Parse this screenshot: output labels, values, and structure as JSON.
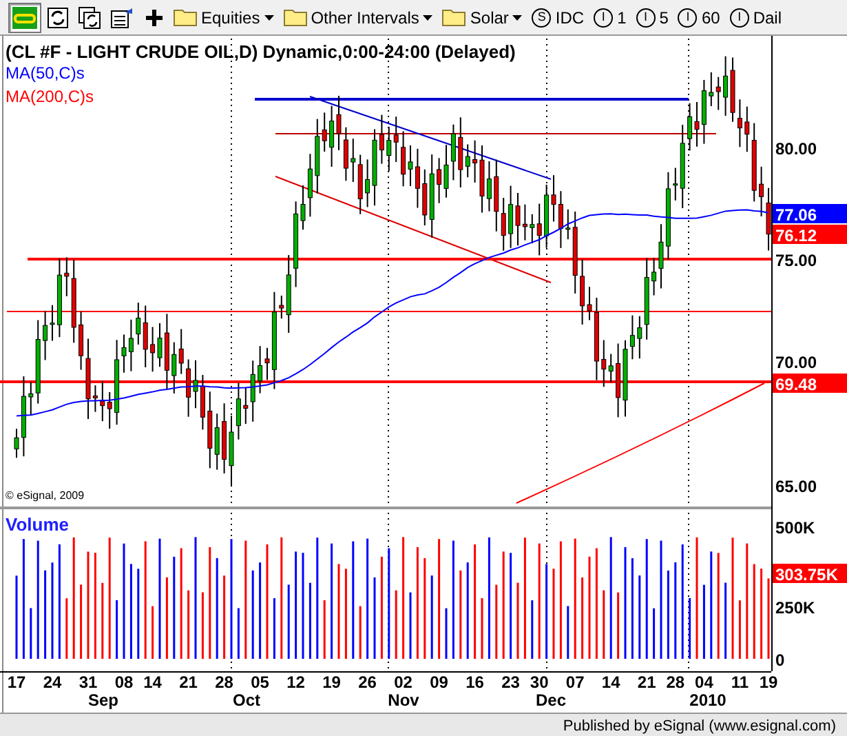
{
  "toolbar": {
    "buttons": [
      {
        "kind": "link",
        "selected": true
      },
      {
        "kind": "refresh",
        "selected": false
      },
      {
        "kind": "refresh-all",
        "selected": false
      },
      {
        "kind": "properties",
        "selected": false
      },
      {
        "kind": "add",
        "selected": false
      }
    ],
    "menus": [
      {
        "label": "Equities"
      },
      {
        "label": "Other Intervals"
      },
      {
        "label": "Solar"
      }
    ],
    "intervals": [
      {
        "badge": "S",
        "label": "IDC"
      },
      {
        "badge": "I",
        "label": "1"
      },
      {
        "badge": "I",
        "label": "5"
      },
      {
        "badge": "I",
        "label": "60"
      },
      {
        "badge": "I",
        "label": "Dail"
      }
    ]
  },
  "chart": {
    "title": "(CL #F - LIGHT CRUDE OIL,D) Dynamic,0:00-24:00 (Delayed)",
    "legends": [
      {
        "label": "MA(50,C)s",
        "color": "#0000ff"
      },
      {
        "label": "MA(200,C)s",
        "color": "#ff0000"
      }
    ],
    "y_ticks": [
      "80.00",
      "75.00",
      "70.00",
      "65.00"
    ],
    "price_badges": [
      {
        "value": "77.06",
        "color": "#0000ff"
      },
      {
        "value": "76.12",
        "color": "#ff0000"
      },
      {
        "value": "69.48",
        "color": "#ff0000"
      }
    ],
    "copyright": "© eSignal, 2009",
    "volume": {
      "label": "Volume",
      "ticks": [
        "500K",
        "250K",
        "0"
      ],
      "badge": "303.75K"
    },
    "x_dates": [
      "17",
      "24",
      "31",
      "08",
      "14",
      "21",
      "28",
      "05",
      "12",
      "19",
      "26",
      "02",
      "09",
      "16",
      "23",
      "30",
      "07",
      "14",
      "21",
      "28",
      "04",
      "11",
      "19"
    ],
    "x_months": [
      "Sep",
      "Oct",
      "Nov",
      "Dec",
      "2010"
    ]
  },
  "status_bar": {
    "text": "Published by eSignal (www.esignal.com)"
  }
}
